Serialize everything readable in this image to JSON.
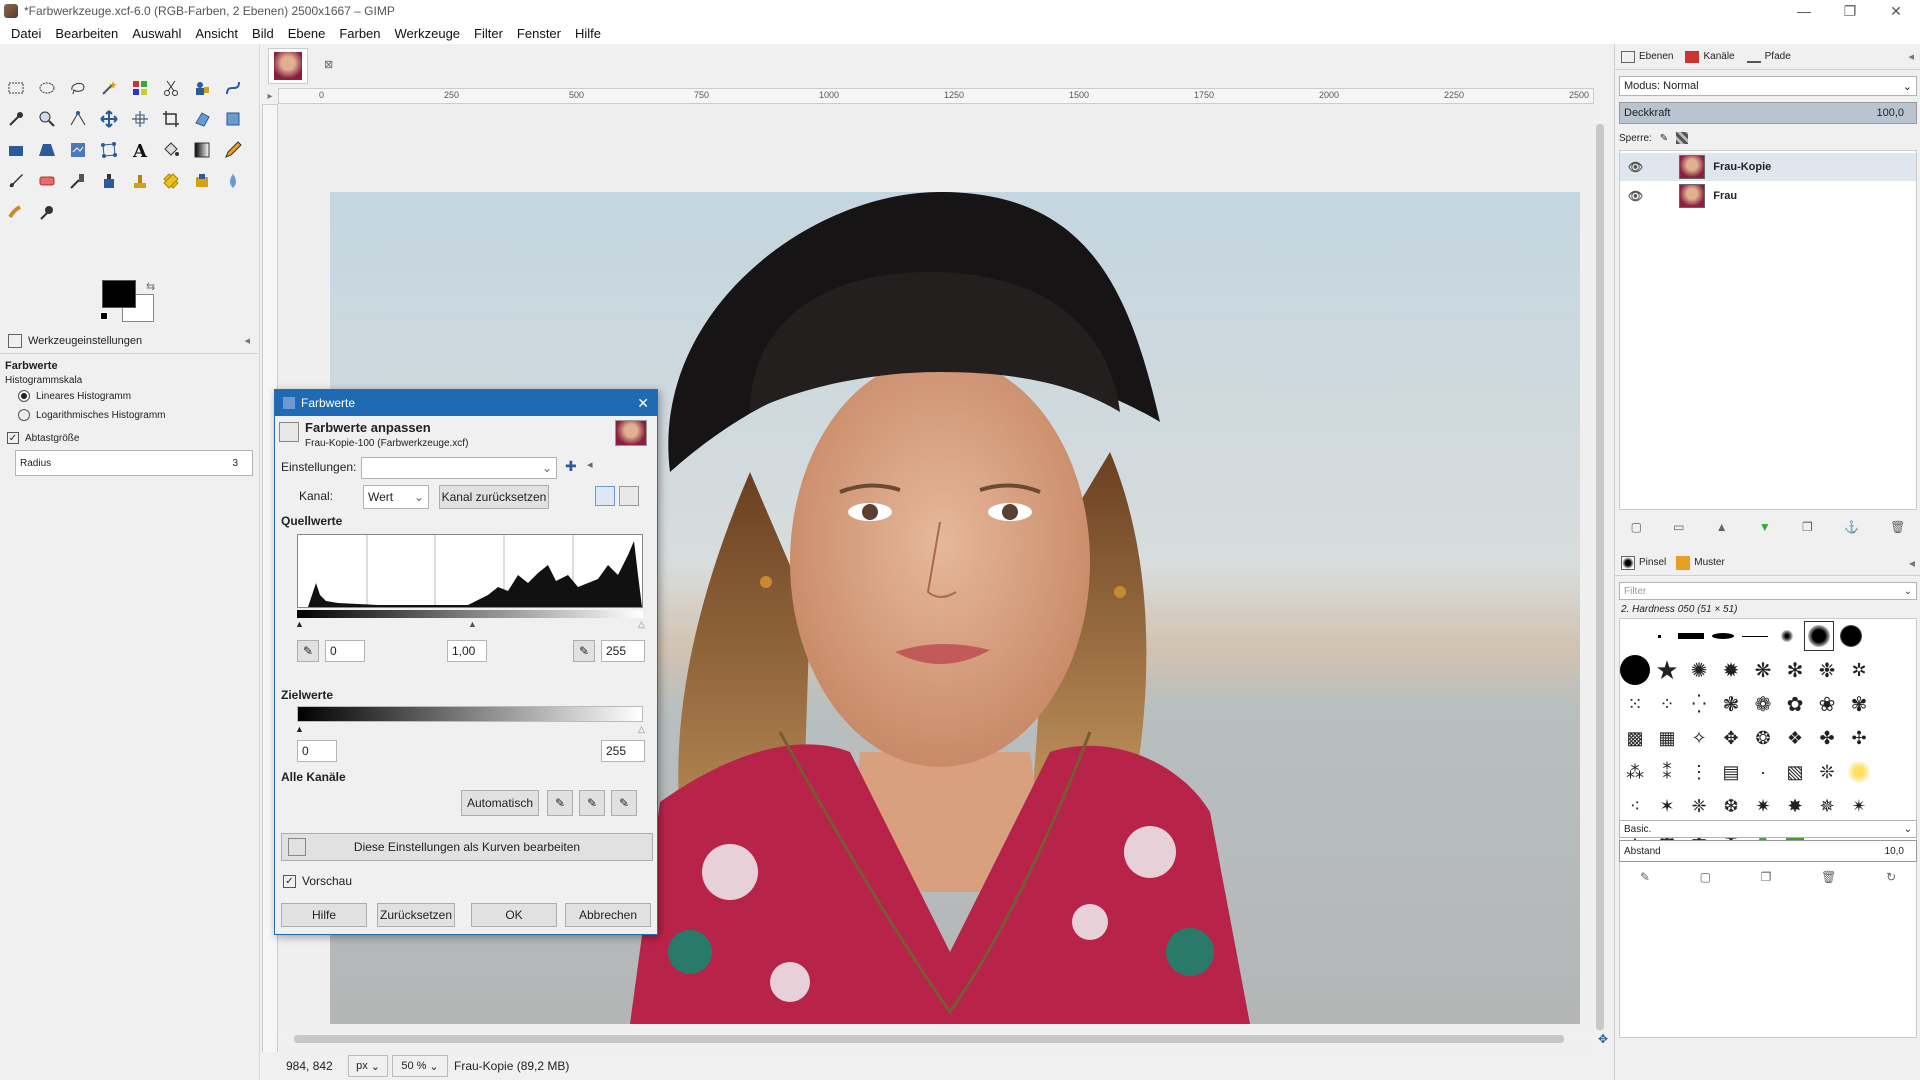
{
  "window": {
    "title": "*Farbwerkzeuge.xcf-6.0 (RGB-Farben, 2 Ebenen) 2500x1667 – GIMP"
  },
  "menu": [
    "Datei",
    "Bearbeiten",
    "Auswahl",
    "Ansicht",
    "Bild",
    "Ebene",
    "Farben",
    "Werkzeuge",
    "Filter",
    "Fenster",
    "Hilfe"
  ],
  "tool_options": {
    "tab_label": "Werkzeugeinstellungen",
    "heading": "Farbwerte",
    "histogram_scale_label": "Histogrammskala",
    "linear_label": "Lineares Histogramm",
    "log_label": "Logarithmisches Histogramm",
    "sample_size_label": "Abtastgröße",
    "radius_label": "Radius",
    "radius_value": "3"
  },
  "ruler": {
    "ticks": [
      "0",
      "250",
      "500",
      "750",
      "1000",
      "1250",
      "1500",
      "1750",
      "2000",
      "2250",
      "2500"
    ]
  },
  "status": {
    "coords": "984, 842",
    "unit": "px",
    "zoom": "50 %",
    "layer_info": "Frau-Kopie (89,2 MB)"
  },
  "dialog": {
    "title": "Farbwerte",
    "heading": "Farbwerte anpassen",
    "subtitle": "Frau-Kopie-100 (Farbwerkzeuge.xcf)",
    "presets_label": "Einstellungen:",
    "channel_label": "Kanal:",
    "channel_value": "Wert",
    "reset_channel": "Kanal zurücksetzen",
    "input_levels": "Quellwerte",
    "input_low": "0",
    "gamma": "1,00",
    "input_high": "255",
    "output_levels": "Zielwerte",
    "output_low": "0",
    "output_high": "255",
    "all_channels": "Alle Kanäle",
    "auto": "Automatisch",
    "edit_as_curves": "Diese Einstellungen als Kurven bearbeiten",
    "preview": "Vorschau",
    "help": "Hilfe",
    "reset": "Zurücksetzen",
    "ok": "OK",
    "cancel": "Abbrechen"
  },
  "layers_dock": {
    "tabs": [
      "Ebenen",
      "Kanäle",
      "Pfade"
    ],
    "mode": "Modus: Normal",
    "opacity_label": "Deckkraft",
    "opacity_value": "100,0",
    "lock_label": "Sperre:",
    "layers": [
      "Frau-Kopie",
      "Frau"
    ]
  },
  "brushes_dock": {
    "tabs": [
      "Pinsel",
      "Muster"
    ],
    "filter_placeholder": "Filter",
    "brush_name": "2. Hardness 050 (51 × 51)",
    "preset": "Basic.",
    "spacing_label": "Abstand",
    "spacing_value": "10,0"
  },
  "colors": {
    "accent": "#1f6bb3",
    "fg": "#000000",
    "bg": "#ffffff"
  }
}
